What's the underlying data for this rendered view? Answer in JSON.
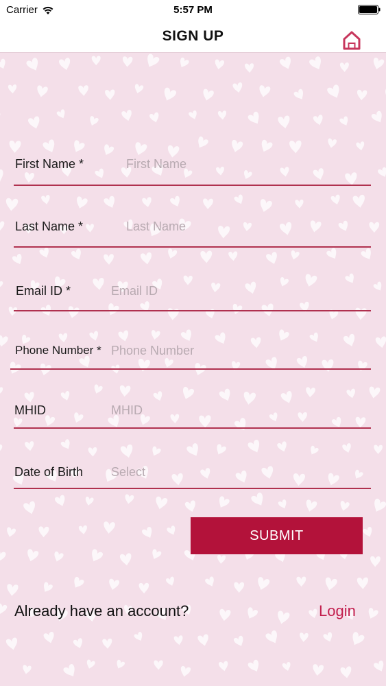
{
  "status_bar": {
    "carrier": "Carrier",
    "time": "5:57 PM"
  },
  "nav": {
    "title": "SIGN UP",
    "home_icon": "home-icon"
  },
  "form": {
    "fields": [
      {
        "label": "First Name *",
        "placeholder": "First Name"
      },
      {
        "label": "Last Name *",
        "placeholder": "Last Name"
      },
      {
        "label": "Email ID *",
        "placeholder": "Email ID"
      },
      {
        "label": "Phone Number *",
        "placeholder": "Phone Number"
      },
      {
        "label": "MHID",
        "placeholder": "MHID"
      },
      {
        "label": "Date of Birth",
        "placeholder": "Select"
      }
    ],
    "submit_label": "SUBMIT"
  },
  "footer": {
    "prompt": "Already have an account?",
    "login_label": "Login"
  },
  "colors": {
    "background": "#f4dfe9",
    "accent": "#b3123a",
    "link": "#c21e4d",
    "underline": "#b0314f"
  }
}
